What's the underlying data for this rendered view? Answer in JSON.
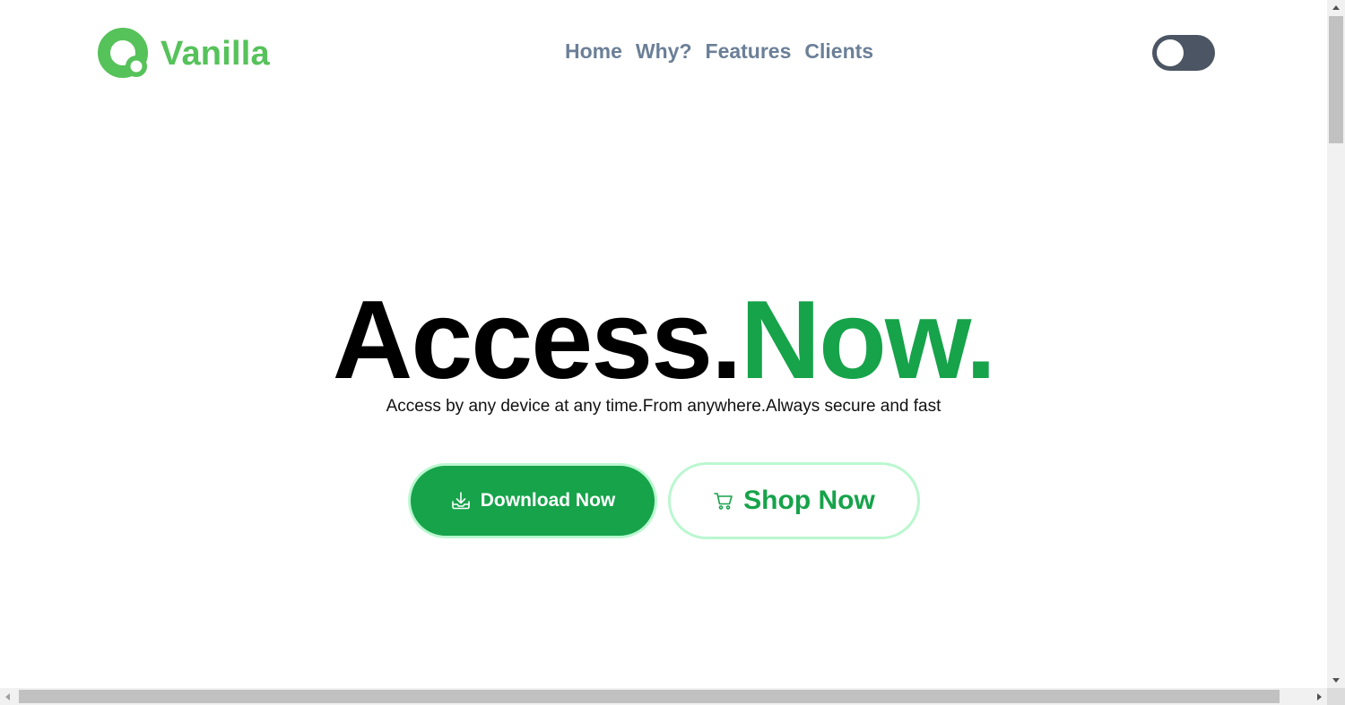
{
  "brand": {
    "name": "Vanilla",
    "color": "#56c25a",
    "icon": "vanilla-logo-icon"
  },
  "nav": {
    "items": [
      {
        "label": "Home"
      },
      {
        "label": "Why?"
      },
      {
        "label": "Features"
      },
      {
        "label": "Clients"
      }
    ],
    "color": "#6b7f97"
  },
  "theme_toggle": {
    "state": "off",
    "icon": "toggle-switch"
  },
  "hero": {
    "title_part1": "Access.",
    "title_part2": "Now.",
    "subtitle": "Access by any device at any time.From anywhere.Always secure and fast",
    "accent": "#16a34a"
  },
  "buttons": {
    "download": {
      "label": "Download Now",
      "icon": "download-icon"
    },
    "shop": {
      "label": "Shop Now",
      "icon": "cart-icon"
    }
  }
}
